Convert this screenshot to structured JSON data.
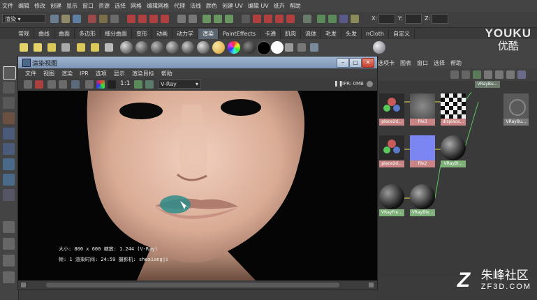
{
  "main_menu": [
    "文件",
    "编辑",
    "修改",
    "创建",
    "显示",
    "窗口",
    "资源",
    "选择",
    "网格",
    "编辑网格",
    "代理",
    "法线",
    "颜色",
    "创建 UV",
    "编辑 UV",
    "纸卉",
    "帮助"
  ],
  "status_line": {
    "menu_set": "渲染",
    "coord_labels": [
      "X:",
      "Y:",
      "Z:"
    ]
  },
  "shelf_tabs": [
    "常规",
    "曲线",
    "曲面",
    "多边形",
    "细分曲面",
    "变形",
    "动画",
    "动力学",
    "渲染",
    "PaintEffects",
    "卡通",
    "肌肉",
    "流体",
    "毛发",
    "头发",
    "nCloth",
    "自定义"
  ],
  "shelf_tabs_active": 8,
  "render_window": {
    "title": "渲染视图",
    "menu": [
      "文件",
      "视图",
      "渲染",
      "IPR",
      "选项",
      "显示",
      "渲染目标",
      "帮助"
    ],
    "ratio": "1:1",
    "renderer": "V-Ray",
    "ipr_status": "IPR: 0MB",
    "info_line1": "大小: 800 x 600  缩放: 1.244        (V-Ray)",
    "info_line2": "帧: 1      渲染时间: 24:59          摄影机: shexiangji"
  },
  "hypershade": {
    "menu": [
      "选项卡",
      "图表",
      "窗口",
      "选择",
      "帮助"
    ],
    "nodes": [
      {
        "label": "VRayBu...",
        "kind": "blank-top"
      },
      {
        "label": "place2d...",
        "kind": "place2d"
      },
      {
        "label": "file3",
        "kind": "file-skin"
      },
      {
        "label": "displace...",
        "kind": "checker"
      },
      {
        "label": "VRayBu...",
        "kind": "blank-right"
      },
      {
        "label": "VRayBl...",
        "kind": "vraybl"
      },
      {
        "label": "place2d...",
        "kind": "place2d"
      },
      {
        "label": "file2",
        "kind": "file-blue"
      },
      {
        "label": "VRayBl...",
        "kind": "vrayball"
      },
      {
        "label": "VRayFre...",
        "kind": "vrayfre"
      },
      {
        "label": "VRayBle...",
        "kind": "vrayball2"
      }
    ]
  },
  "watermarks": {
    "youku_en": "YOUKU",
    "youku_cn": "优酷",
    "zf_cn": "朱峰社区",
    "zf_url": "ZF3D.COM"
  },
  "colors": {
    "accent_tab": "#5a6570",
    "title_bar": "#8ea6c4",
    "node_green": "#7fb07a",
    "node_pink": "#c98585",
    "node_blue": "#7b86f2"
  }
}
